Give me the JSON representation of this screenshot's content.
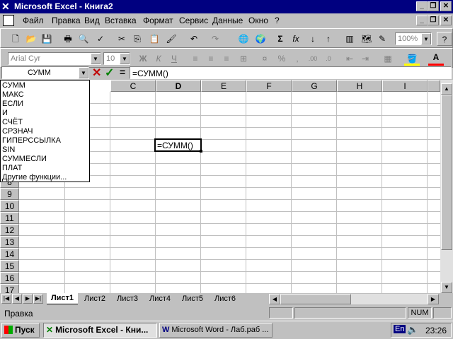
{
  "window": {
    "title": "Microsoft Excel - Книга2"
  },
  "menu": [
    "Файл",
    "Правка",
    "Вид",
    "Вставка",
    "Формат",
    "Сервис",
    "Данные",
    "Окно",
    "?"
  ],
  "toolbar": {
    "zoom": "100%",
    "font": "Arial Cyr",
    "size": "10"
  },
  "formula_bar": {
    "name_box": "СУММ",
    "equals": "=",
    "formula": "=СУММ()"
  },
  "function_list": [
    "СУММ",
    "МАКС",
    "ЕСЛИ",
    "И",
    "СЧЁТ",
    "СРЗНАЧ",
    "ГИПЕРССЫЛКА",
    "SIN",
    "СУММЕСЛИ",
    "ПЛАТ",
    "Другие функции..."
  ],
  "columns": [
    "C",
    "D",
    "E",
    "F",
    "G",
    "H",
    "I"
  ],
  "rows": [
    "8",
    "9",
    "10",
    "11",
    "12",
    "13",
    "14",
    "15",
    "16",
    "17"
  ],
  "active_cell": {
    "value": "=СУММ()"
  },
  "sheets": [
    "Лист1",
    "Лист2",
    "Лист3",
    "Лист4",
    "Лист5",
    "Лист6"
  ],
  "status": {
    "text": "Правка",
    "num": "NUM"
  },
  "taskbar": {
    "start": "Пуск",
    "task1": "Microsoft Excel - Кни...",
    "task2": "Microsoft Word - Лаб.раб ...",
    "lang": "En",
    "clock": "23:26"
  }
}
